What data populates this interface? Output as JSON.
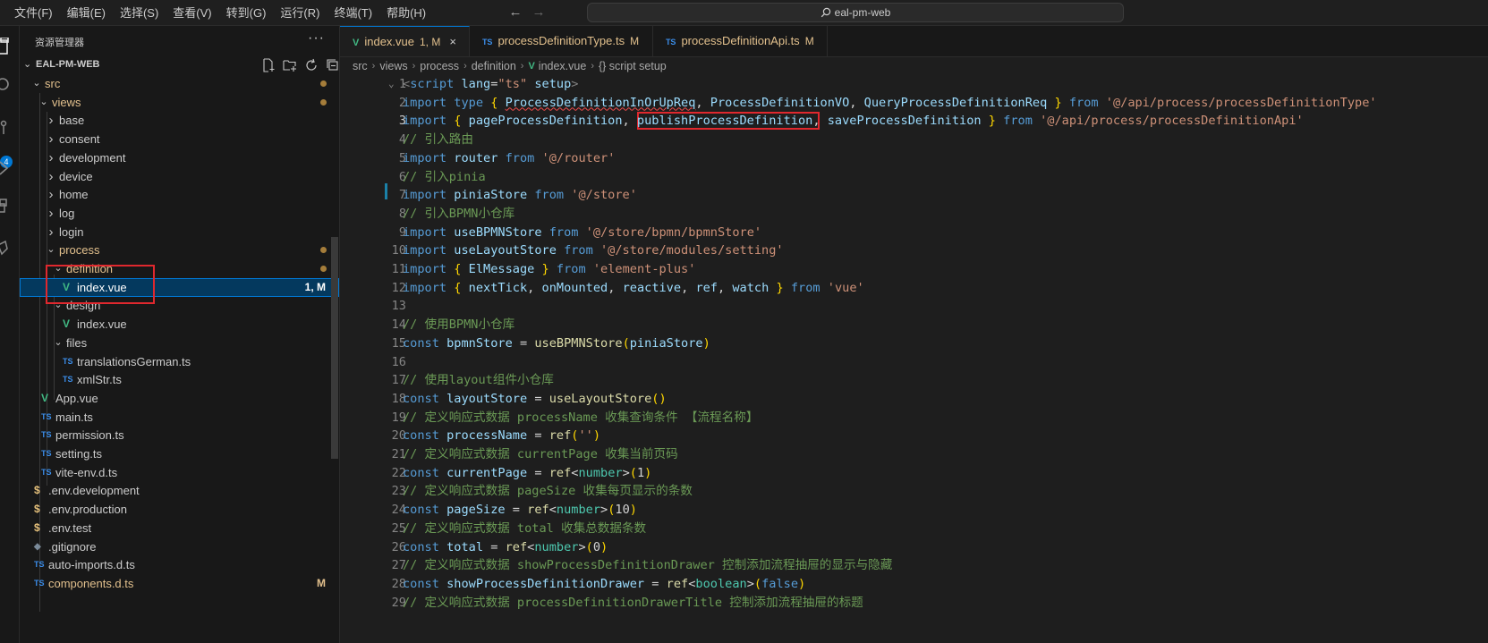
{
  "menu": [
    "文件(F)",
    "编辑(E)",
    "选择(S)",
    "查看(V)",
    "转到(G)",
    "运行(R)",
    "终端(T)",
    "帮助(H)"
  ],
  "titlebar": {
    "search_text": "eal-pm-web"
  },
  "activity": {
    "badge": "4"
  },
  "sidebar": {
    "title": "资源管理器",
    "more": "···",
    "root": "EAL-PM-WEB",
    "tree": [
      {
        "label": "src",
        "kind": "folder-open",
        "modified": true
      },
      {
        "label": "views",
        "kind": "folder-open",
        "modified": true
      },
      {
        "label": "base",
        "kind": "folder"
      },
      {
        "label": "consent",
        "kind": "folder"
      },
      {
        "label": "development",
        "kind": "folder"
      },
      {
        "label": "device",
        "kind": "folder"
      },
      {
        "label": "home",
        "kind": "folder"
      },
      {
        "label": "log",
        "kind": "folder"
      },
      {
        "label": "login",
        "kind": "folder"
      },
      {
        "label": "process",
        "kind": "folder-open",
        "modified": true
      },
      {
        "label": "definition",
        "kind": "folder-open",
        "modified": true
      },
      {
        "label": "index.vue",
        "kind": "vue",
        "badge": "1, M"
      },
      {
        "label": "design",
        "kind": "folder-open"
      },
      {
        "label": "index.vue",
        "kind": "vue"
      },
      {
        "label": "files",
        "kind": "folder-open"
      },
      {
        "label": "translationsGerman.ts",
        "kind": "ts"
      },
      {
        "label": "xmlStr.ts",
        "kind": "ts"
      },
      {
        "label": "App.vue",
        "kind": "vue"
      },
      {
        "label": "main.ts",
        "kind": "ts"
      },
      {
        "label": "permission.ts",
        "kind": "ts"
      },
      {
        "label": "setting.ts",
        "kind": "ts"
      },
      {
        "label": "vite-env.d.ts",
        "kind": "ts"
      },
      {
        "label": ".env.development",
        "kind": "env"
      },
      {
        "label": ".env.production",
        "kind": "env"
      },
      {
        "label": ".env.test",
        "kind": "env"
      },
      {
        "label": ".gitignore",
        "kind": "git"
      },
      {
        "label": "auto-imports.d.ts",
        "kind": "ts"
      },
      {
        "label": "components.d.ts",
        "kind": "ts",
        "badge": "M"
      }
    ]
  },
  "tabs": [
    {
      "icon": "V",
      "label": "index.vue",
      "state": "1, M",
      "close": "×"
    },
    {
      "icon": "TS",
      "label": "processDefinitionType.ts",
      "state": "M"
    },
    {
      "icon": "TS",
      "label": "processDefinitionApi.ts",
      "state": "M"
    }
  ],
  "breadcrumb": [
    "src",
    "views",
    "process",
    "definition",
    "index.vue",
    "{} script setup"
  ],
  "code": {
    "line_numbers": [
      "1",
      "2",
      "3",
      "4",
      "5",
      "6",
      "7",
      "8",
      "9",
      "10",
      "11",
      "12",
      "13",
      "14",
      "15",
      "16",
      "17",
      "18",
      "19",
      "20",
      "21",
      "22",
      "23",
      "24",
      "25",
      "26",
      "27",
      "28",
      "29"
    ],
    "lines": [
      [
        [
          "tag",
          "<"
        ],
        [
          "k",
          "script"
        ],
        [
          "i",
          " lang"
        ],
        [
          "p",
          "="
        ],
        [
          "s",
          "\"ts\""
        ],
        [
          "i",
          " setup"
        ],
        [
          "tag",
          ">"
        ]
      ],
      [
        [
          "k",
          "import"
        ],
        [
          "p",
          " "
        ],
        [
          "k",
          "type"
        ],
        [
          "p",
          " "
        ],
        [
          "b1",
          "{"
        ],
        [
          "p",
          " "
        ],
        [
          "i",
          "ProcessDefinitionInOrUpReq"
        ],
        [
          "p",
          ", "
        ],
        [
          "i",
          "ProcessDefinitionVO"
        ],
        [
          "p",
          ", "
        ],
        [
          "i",
          "QueryProcessDefinitionReq"
        ],
        [
          "p",
          " "
        ],
        [
          "b1",
          "}"
        ],
        [
          "p",
          " "
        ],
        [
          "k",
          "from"
        ],
        [
          "p",
          " "
        ],
        [
          "s",
          "'@/api/process/processDefinitionType'"
        ]
      ],
      [
        [
          "k",
          "import"
        ],
        [
          "p",
          " "
        ],
        [
          "b1",
          "{"
        ],
        [
          "p",
          " "
        ],
        [
          "i",
          "pageProcessDefinition"
        ],
        [
          "p",
          ", "
        ],
        [
          "i",
          "publishProcessDefinition"
        ],
        [
          "p",
          ", "
        ],
        [
          "i",
          "saveProcessDefinition"
        ],
        [
          "p",
          " "
        ],
        [
          "b1",
          "}"
        ],
        [
          "p",
          " "
        ],
        [
          "k",
          "from"
        ],
        [
          "p",
          " "
        ],
        [
          "s",
          "'@/api/process/processDefinitionApi'"
        ]
      ],
      [
        [
          "c",
          "// 引入路由"
        ]
      ],
      [
        [
          "k",
          "import"
        ],
        [
          "p",
          " "
        ],
        [
          "i",
          "router"
        ],
        [
          "p",
          " "
        ],
        [
          "k",
          "from"
        ],
        [
          "p",
          " "
        ],
        [
          "s",
          "'@/router'"
        ]
      ],
      [
        [
          "c",
          "// 引入pinia"
        ]
      ],
      [
        [
          "k",
          "import"
        ],
        [
          "p",
          " "
        ],
        [
          "i",
          "piniaStore"
        ],
        [
          "p",
          " "
        ],
        [
          "k",
          "from"
        ],
        [
          "p",
          " "
        ],
        [
          "s",
          "'@/store'"
        ]
      ],
      [
        [
          "c",
          "// 引入BPMN小仓库"
        ]
      ],
      [
        [
          "k",
          "import"
        ],
        [
          "p",
          " "
        ],
        [
          "i",
          "useBPMNStore"
        ],
        [
          "p",
          " "
        ],
        [
          "k",
          "from"
        ],
        [
          "p",
          " "
        ],
        [
          "s",
          "'@/store/bpmn/bpmnStore'"
        ]
      ],
      [
        [
          "k",
          "import"
        ],
        [
          "p",
          " "
        ],
        [
          "i",
          "useLayoutStore"
        ],
        [
          "p",
          " "
        ],
        [
          "k",
          "from"
        ],
        [
          "p",
          " "
        ],
        [
          "s",
          "'@/store/modules/setting'"
        ]
      ],
      [
        [
          "k",
          "import"
        ],
        [
          "p",
          " "
        ],
        [
          "b1",
          "{"
        ],
        [
          "p",
          " "
        ],
        [
          "i",
          "ElMessage"
        ],
        [
          "p",
          " "
        ],
        [
          "b1",
          "}"
        ],
        [
          "p",
          " "
        ],
        [
          "k",
          "from"
        ],
        [
          "p",
          " "
        ],
        [
          "s",
          "'element-plus'"
        ]
      ],
      [
        [
          "k",
          "import"
        ],
        [
          "p",
          " "
        ],
        [
          "b1",
          "{"
        ],
        [
          "p",
          " "
        ],
        [
          "i",
          "nextTick"
        ],
        [
          "p",
          ", "
        ],
        [
          "i",
          "onMounted"
        ],
        [
          "p",
          ", "
        ],
        [
          "i",
          "reactive"
        ],
        [
          "p",
          ", "
        ],
        [
          "i",
          "ref"
        ],
        [
          "p",
          ", "
        ],
        [
          "i",
          "watch"
        ],
        [
          "p",
          " "
        ],
        [
          "b1",
          "}"
        ],
        [
          "p",
          " "
        ],
        [
          "k",
          "from"
        ],
        [
          "p",
          " "
        ],
        [
          "s",
          "'vue'"
        ]
      ],
      [],
      [
        [
          "c",
          "// 使用BPMN小仓库"
        ]
      ],
      [
        [
          "k",
          "const"
        ],
        [
          "p",
          " "
        ],
        [
          "i",
          "bpmnStore"
        ],
        [
          "p",
          " = "
        ],
        [
          "f",
          "useBPMNStore"
        ],
        [
          "b1",
          "("
        ],
        [
          "i",
          "piniaStore"
        ],
        [
          "b1",
          ")"
        ]
      ],
      [],
      [
        [
          "c",
          "// 使用layout组件小仓库"
        ]
      ],
      [
        [
          "k",
          "const"
        ],
        [
          "p",
          " "
        ],
        [
          "i",
          "layoutStore"
        ],
        [
          "p",
          " = "
        ],
        [
          "f",
          "useLayoutStore"
        ],
        [
          "b1",
          "()"
        ]
      ],
      [
        [
          "c",
          "// 定义响应式数据 processName 收集查询条件 【流程名称】"
        ]
      ],
      [
        [
          "k",
          "const"
        ],
        [
          "p",
          " "
        ],
        [
          "i",
          "processName"
        ],
        [
          "p",
          " = "
        ],
        [
          "f",
          "ref"
        ],
        [
          "b1",
          "("
        ],
        [
          "s",
          "''"
        ],
        [
          "b1",
          ")"
        ]
      ],
      [
        [
          "c",
          "// 定义响应式数据 currentPage 收集当前页码"
        ]
      ],
      [
        [
          "k",
          "const"
        ],
        [
          "p",
          " "
        ],
        [
          "i",
          "currentPage"
        ],
        [
          "p",
          " = "
        ],
        [
          "f",
          "ref"
        ],
        [
          "p",
          "<"
        ],
        [
          "t",
          "number"
        ],
        [
          "p",
          ">"
        ],
        [
          "b1",
          "("
        ],
        [
          "p",
          "1"
        ],
        [
          "b1",
          ")"
        ]
      ],
      [
        [
          "c",
          "// 定义响应式数据 pageSize 收集每页显示的条数"
        ]
      ],
      [
        [
          "k",
          "const"
        ],
        [
          "p",
          " "
        ],
        [
          "i",
          "pageSize"
        ],
        [
          "p",
          " = "
        ],
        [
          "f",
          "ref"
        ],
        [
          "p",
          "<"
        ],
        [
          "t",
          "number"
        ],
        [
          "p",
          ">"
        ],
        [
          "b1",
          "("
        ],
        [
          "p",
          "10"
        ],
        [
          "b1",
          ")"
        ]
      ],
      [
        [
          "c",
          "// 定义响应式数据 total 收集总数据条数"
        ]
      ],
      [
        [
          "k",
          "const"
        ],
        [
          "p",
          " "
        ],
        [
          "i",
          "total"
        ],
        [
          "p",
          " = "
        ],
        [
          "f",
          "ref"
        ],
        [
          "p",
          "<"
        ],
        [
          "t",
          "number"
        ],
        [
          "p",
          ">"
        ],
        [
          "b1",
          "("
        ],
        [
          "p",
          "0"
        ],
        [
          "b1",
          ")"
        ]
      ],
      [
        [
          "c",
          "// 定义响应式数据 showProcessDefinitionDrawer 控制添加流程抽屉的显示与隐藏"
        ]
      ],
      [
        [
          "k",
          "const"
        ],
        [
          "p",
          " "
        ],
        [
          "i",
          "showProcessDefinitionDrawer"
        ],
        [
          "p",
          " = "
        ],
        [
          "f",
          "ref"
        ],
        [
          "p",
          "<"
        ],
        [
          "t",
          "boolean"
        ],
        [
          "p",
          ">"
        ],
        [
          "b1",
          "("
        ],
        [
          "k",
          "false"
        ],
        [
          "b1",
          ")"
        ]
      ],
      [
        [
          "c",
          "// 定义响应式数据 processDefinitionDrawerTitle 控制添加流程抽屉的标题"
        ]
      ]
    ]
  },
  "colors": {
    "accent": "#0078d4",
    "highlight_box": "#e0282e"
  }
}
